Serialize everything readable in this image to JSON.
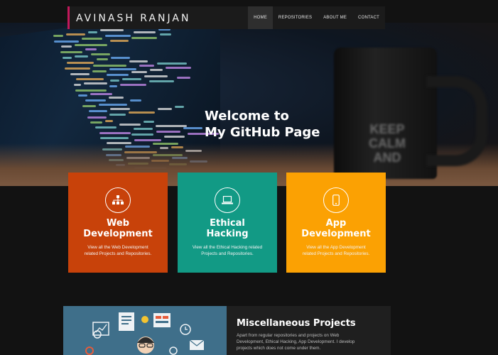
{
  "brand": {
    "name": "AVINASH RANJAN"
  },
  "nav": {
    "items": [
      {
        "label": "HOME",
        "active": true
      },
      {
        "label": "REPOSITORIES",
        "active": false
      },
      {
        "label": "ABOUT ME",
        "active": false
      },
      {
        "label": "CONTACT",
        "active": false
      }
    ]
  },
  "hero": {
    "title_line1": "Welcome to",
    "title_line2": "My GitHub Page"
  },
  "cards": [
    {
      "title_line1": "Web",
      "title_line2": "Development",
      "desc_line1": "View all the Web Development",
      "desc_line2": "related Projects and Repositories.",
      "color": "#c8420a",
      "icon": "sitemap-icon"
    },
    {
      "title_line1": "Ethical",
      "title_line2": "Hacking",
      "desc_line1": "View all the Ethical Hacking related",
      "desc_line2": "Projects and Repositories.",
      "color": "#129a85",
      "icon": "laptop-icon"
    },
    {
      "title_line1": "App",
      "title_line2": "Development",
      "desc_line1": "View all the App Development",
      "desc_line2": "related Projects and Repositories.",
      "color": "#fba103",
      "icon": "mobile-icon"
    }
  ],
  "misc": {
    "title": "Miscellaneous Projects",
    "desc_line1": "Apart from regular repositories and projects on Web",
    "desc_line2": "Development, Ethical Hacking, App Development. I develop",
    "desc_line3": "projects which does not come under them."
  },
  "mug": {
    "text_line1": "KEEP",
    "text_line2": "CALM",
    "text_line3": "AND"
  }
}
